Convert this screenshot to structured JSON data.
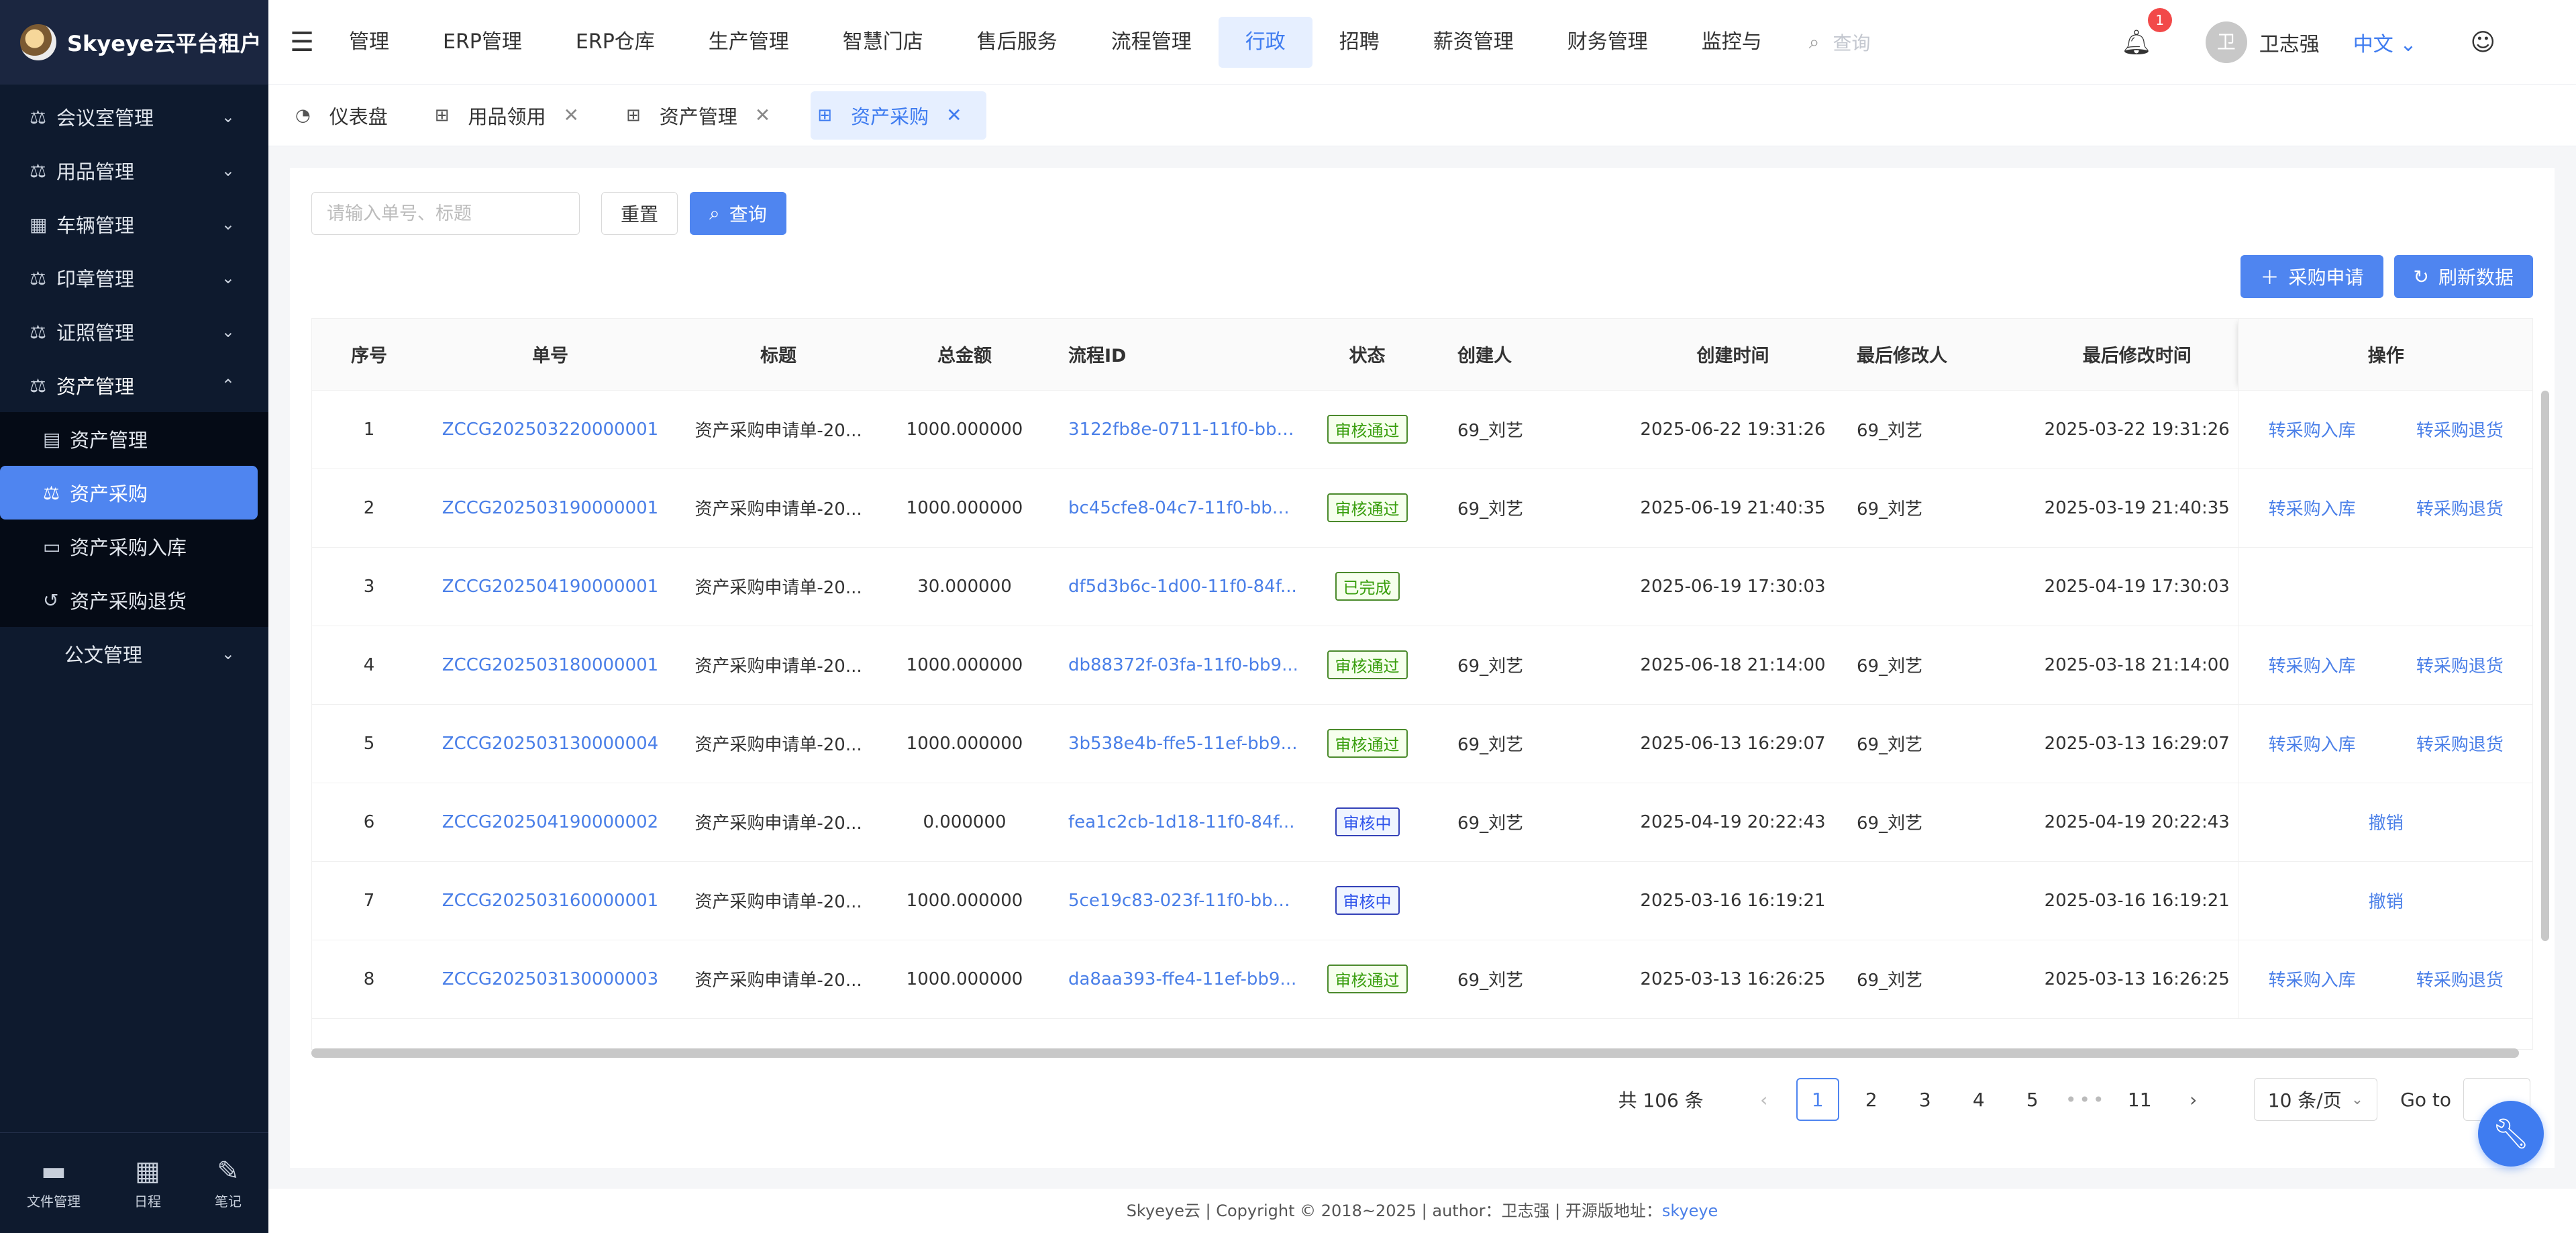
{
  "brand": {
    "title": "Skyeye云平台租户"
  },
  "sidebar": {
    "items": [
      {
        "label": "会议室管理",
        "icon": "scale-icon"
      },
      {
        "label": "用品管理",
        "icon": "scale-icon"
      },
      {
        "label": "车辆管理",
        "icon": "archive-icon"
      },
      {
        "label": "印章管理",
        "icon": "scale-icon"
      },
      {
        "label": "证照管理",
        "icon": "scale-icon"
      },
      {
        "label": "资产管理",
        "icon": "scale-icon",
        "expanded": true
      }
    ],
    "subitems": [
      {
        "label": "资产管理",
        "icon": "list-icon"
      },
      {
        "label": "资产采购",
        "icon": "scale-icon",
        "active": true
      },
      {
        "label": "资产采购入库",
        "icon": "folder-icon"
      },
      {
        "label": "资产采购退货",
        "icon": "undo-icon"
      }
    ],
    "last_item": {
      "label": "公文管理"
    },
    "tools": [
      {
        "label": "文件管理",
        "icon": "folder-icon"
      },
      {
        "label": "日程",
        "icon": "calendar-icon"
      },
      {
        "label": "笔记",
        "icon": "edit-icon"
      }
    ]
  },
  "topnav": {
    "items": [
      "管理",
      "ERP管理",
      "ERP仓库",
      "生产管理",
      "智慧门店",
      "售后服务",
      "流程管理",
      "行政",
      "招聘",
      "薪资管理",
      "财务管理",
      "监控与"
    ],
    "active": "行政",
    "search_placeholder": "查询",
    "notification_count": "1",
    "avatar_char": "卫",
    "username": "卫志强",
    "language": "中文"
  },
  "tabs": [
    {
      "label": "仪表盘",
      "closable": false
    },
    {
      "label": "用品领用",
      "closable": true
    },
    {
      "label": "资产管理",
      "closable": true
    },
    {
      "label": "资产采购",
      "closable": true,
      "active": true
    }
  ],
  "search": {
    "placeholder": "请输入单号、标题",
    "reset_label": "重置",
    "query_label": "查询"
  },
  "actions": {
    "apply_label": "采购申请",
    "refresh_label": "刷新数据"
  },
  "table": {
    "columns": [
      "序号",
      "单号",
      "标题",
      "总金额",
      "流程ID",
      "状态",
      "创建人",
      "创建时间",
      "最后修改人",
      "最后修改时间",
      "操作"
    ],
    "rows": [
      {
        "no": "1",
        "code": "ZCCG202503220000001",
        "title": "资产采购申请单-20...",
        "amount": "1000.000000",
        "flow": "3122fb8e-0711-11f0-bb9...",
        "status": "审核通过",
        "status_type": "green",
        "creator": "69_刘艺",
        "created": "2025-06-22 19:31:26",
        "modifier": "69_刘艺",
        "modified": "2025-03-22 19:31:26",
        "ops": [
          "转采购入库",
          "转采购退货"
        ]
      },
      {
        "no": "2",
        "code": "ZCCG202503190000001",
        "title": "资产采购申请单-20...",
        "amount": "1000.000000",
        "flow": "bc45cfe8-04c7-11f0-bb9...",
        "status": "审核通过",
        "status_type": "green",
        "creator": "69_刘艺",
        "created": "2025-06-19 21:40:35",
        "modifier": "69_刘艺",
        "modified": "2025-03-19 21:40:35",
        "ops": [
          "转采购入库",
          "转采购退货"
        ]
      },
      {
        "no": "3",
        "code": "ZCCG202504190000001",
        "title": "资产采购申请单-20...",
        "amount": "30.000000",
        "flow": "df5d3b6c-1d00-11f0-84f...",
        "status": "已完成",
        "status_type": "green",
        "creator": "",
        "created": "2025-06-19 17:30:03",
        "modifier": "",
        "modified": "2025-04-19 17:30:03",
        "ops": []
      },
      {
        "no": "4",
        "code": "ZCCG202503180000001",
        "title": "资产采购申请单-20...",
        "amount": "1000.000000",
        "flow": "db88372f-03fa-11f0-bb9...",
        "status": "审核通过",
        "status_type": "green",
        "creator": "69_刘艺",
        "created": "2025-06-18 21:14:00",
        "modifier": "69_刘艺",
        "modified": "2025-03-18 21:14:00",
        "ops": [
          "转采购入库",
          "转采购退货"
        ]
      },
      {
        "no": "5",
        "code": "ZCCG202503130000004",
        "title": "资产采购申请单-20...",
        "amount": "1000.000000",
        "flow": "3b538e4b-ffe5-11ef-bb9...",
        "status": "审核通过",
        "status_type": "green",
        "creator": "69_刘艺",
        "created": "2025-06-13 16:29:07",
        "modifier": "69_刘艺",
        "modified": "2025-03-13 16:29:07",
        "ops": [
          "转采购入库",
          "转采购退货"
        ]
      },
      {
        "no": "6",
        "code": "ZCCG202504190000002",
        "title": "资产采购申请单-20...",
        "amount": "0.000000",
        "flow": "fea1c2cb-1d18-11f0-84f...",
        "status": "审核中",
        "status_type": "blue",
        "creator": "69_刘艺",
        "created": "2025-04-19 20:22:43",
        "modifier": "69_刘艺",
        "modified": "2025-04-19 20:22:43",
        "ops": [
          "撤销"
        ]
      },
      {
        "no": "7",
        "code": "ZCCG202503160000001",
        "title": "资产采购申请单-20...",
        "amount": "1000.000000",
        "flow": "5ce19c83-023f-11f0-bb9...",
        "status": "审核中",
        "status_type": "blue",
        "creator": "",
        "created": "2025-03-16 16:19:21",
        "modifier": "",
        "modified": "2025-03-16 16:19:21",
        "ops": [
          "撤销"
        ]
      },
      {
        "no": "8",
        "code": "ZCCG202503130000003",
        "title": "资产采购申请单-20...",
        "amount": "1000.000000",
        "flow": "da8aa393-ffe4-11ef-bb9...",
        "status": "审核通过",
        "status_type": "green",
        "creator": "69_刘艺",
        "created": "2025-03-13 16:26:25",
        "modifier": "69_刘艺",
        "modified": "2025-03-13 16:26:25",
        "ops": [
          "转采购入库",
          "转采购退货"
        ]
      }
    ]
  },
  "pagination": {
    "total_text": "共 106 条",
    "pages": [
      "1",
      "2",
      "3",
      "4",
      "5"
    ],
    "last_page": "11",
    "current": "1",
    "dots": "•••",
    "page_size": "10 条/页",
    "goto_label": "Go to"
  },
  "footer": {
    "text": "Skyeye云 | Copyright © 2018~2025 | author：卫志强 | 开源版地址：",
    "link": "skyeye"
  },
  "colors": {
    "accent": "#4f85f0",
    "sidebar_bg": "#0e1a2e",
    "tag_green": "#389e0d",
    "tag_blue": "#2f54eb"
  }
}
